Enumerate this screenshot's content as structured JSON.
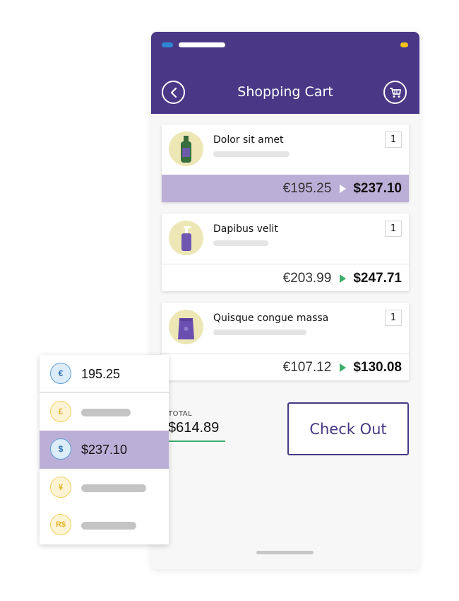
{
  "header": {
    "title": "Shopping Cart",
    "back_icon": "chevron-left-icon",
    "cart_icon": "cart-icon",
    "colors": {
      "header_bg": "#483886",
      "status_blue": "#2d86d4",
      "status_yellow": "#f3c21c"
    }
  },
  "cart": {
    "items": [
      {
        "name": "Dolor sit amet",
        "qty": "1",
        "price_eur": "€195.25",
        "price_usd": "$237.10",
        "highlighted": true,
        "image": "green-bottle-icon"
      },
      {
        "name": "Dapibus velit",
        "qty": "1",
        "price_eur": "€203.99",
        "price_usd": "$247.71",
        "highlighted": false,
        "image": "pump-bottle-icon"
      },
      {
        "name": "Quisque congue massa",
        "qty": "1",
        "price_eur": "€107.12",
        "price_usd": "$130.08",
        "highlighted": false,
        "image": "coffee-bag-icon"
      }
    ]
  },
  "summary": {
    "total_label": "TOTAL",
    "total_value": "$614.89",
    "checkout_label": "Check Out"
  },
  "currency_panel": {
    "options": [
      {
        "symbol": "€",
        "value": "195.25",
        "selected": false
      },
      {
        "symbol": "£",
        "value": "",
        "selected": false
      },
      {
        "symbol": "$",
        "value": "$237.10",
        "selected": true
      },
      {
        "symbol": "¥",
        "value": "",
        "selected": false
      },
      {
        "symbol": "R$",
        "value": "",
        "selected": false
      }
    ],
    "colors": {
      "selected_bg": "#bcafd7",
      "accent_green": "#3fae6d"
    }
  }
}
